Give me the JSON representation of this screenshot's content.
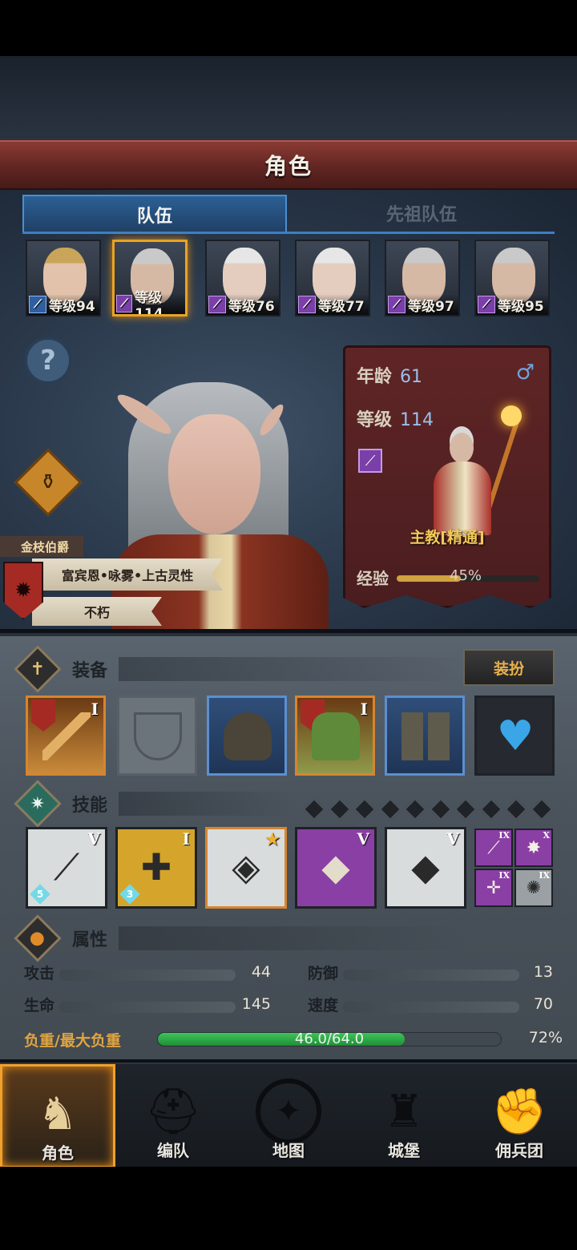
{
  "header": {
    "title": "角色"
  },
  "tabs": [
    {
      "label": "队伍",
      "active": true
    },
    {
      "label": "先祖队伍",
      "active": false
    }
  ],
  "party": [
    {
      "level_text": "等级94",
      "class_icon": "wand-icon",
      "class_color": "#2f5fa0",
      "selected": false
    },
    {
      "level_text": "等级114",
      "class_icon": "staff-icon",
      "class_color": "#7a3fa8",
      "selected": true
    },
    {
      "level_text": "等级76",
      "class_icon": "staff-icon",
      "class_color": "#7a3fa8",
      "selected": false
    },
    {
      "level_text": "等级77",
      "class_icon": "staff-icon",
      "class_color": "#7a3fa8",
      "selected": false
    },
    {
      "level_text": "等级97",
      "class_icon": "staff-icon",
      "class_color": "#7a3fa8",
      "selected": false
    },
    {
      "level_text": "等级95",
      "class_icon": "staff-icon",
      "class_color": "#7a3fa8",
      "selected": false
    }
  ],
  "character": {
    "noble_title": "金枝伯爵",
    "name": "富宾恩•咏雾•上古灵性",
    "trait": "不朽",
    "age_label": "年龄",
    "age": "61",
    "level_label": "等级",
    "level": "114",
    "gender_icon": "male-icon",
    "class_name": "主教[精通]",
    "exp_label": "经验",
    "exp_percent": 45,
    "exp_text": "45%"
  },
  "equipment": {
    "label": "装备",
    "dress_button": "装扮",
    "slots": [
      {
        "name": "staff-weapon",
        "tier": "I",
        "rarity": "orange",
        "crest": true
      },
      {
        "name": "empty-shield",
        "tier": "",
        "rarity": "empty",
        "crest": false
      },
      {
        "name": "hood",
        "tier": "",
        "rarity": "blue",
        "crest": false
      },
      {
        "name": "robe-armor",
        "tier": "I",
        "rarity": "orange",
        "crest": true
      },
      {
        "name": "boots",
        "tier": "",
        "rarity": "blue",
        "crest": false
      },
      {
        "name": "heart-amulet",
        "tier": "",
        "rarity": "none",
        "crest": false
      }
    ]
  },
  "skills": {
    "label": "技能",
    "slot_count": 10,
    "main": [
      {
        "name": "spear-skill",
        "tier": "V",
        "gem": "5",
        "bg": "#d9dcdc"
      },
      {
        "name": "heal-shield-skill",
        "tier": "I",
        "gem": "3",
        "bg": "#d4a52a"
      },
      {
        "name": "crystal-prayer-skill",
        "tier": "★",
        "gem": "",
        "bg": "#d9dcdc"
      },
      {
        "name": "crystal-arm-skill",
        "tier": "V",
        "gem": "",
        "bg": "#8a3fa4"
      },
      {
        "name": "crystal-arm-skill-2",
        "tier": "V",
        "gem": "",
        "bg": "#d9dcdc"
      }
    ],
    "mini": [
      {
        "name": "wand-mini-skill",
        "tier": "IX",
        "bg": "#8a3fa4"
      },
      {
        "name": "burst-mini-skill",
        "tier": "X",
        "bg": "#8a3fa4"
      },
      {
        "name": "target-mini-skill",
        "tier": "IX",
        "bg": "#8a3fa4"
      },
      {
        "name": "explosion-mini-skill",
        "tier": "IX",
        "bg": "#9aa0a4"
      }
    ]
  },
  "attributes": {
    "label": "属性",
    "stats": [
      {
        "label": "攻击",
        "value": "44"
      },
      {
        "label": "防御",
        "value": "13"
      },
      {
        "label": "生命",
        "value": "145"
      },
      {
        "label": "速度",
        "value": "70"
      }
    ],
    "load_label": "负重/最大负重",
    "load_text": "46.0/64.0",
    "load_fraction": 0.72,
    "load_pct": "72%"
  },
  "nav": [
    {
      "label": "角色",
      "icon": "knight-icon",
      "active": true
    },
    {
      "label": "编队",
      "icon": "helmet-icon",
      "active": false
    },
    {
      "label": "地图",
      "icon": "compass-icon",
      "active": false
    },
    {
      "label": "城堡",
      "icon": "castle-icon",
      "active": false
    },
    {
      "label": "佣兵团",
      "icon": "fist-icon",
      "active": false
    }
  ]
}
